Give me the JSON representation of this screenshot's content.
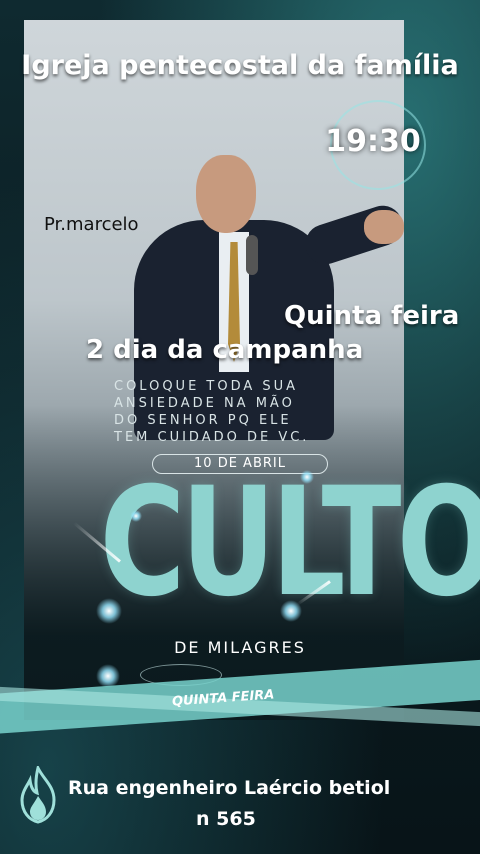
{
  "header": {
    "church_name": "Igreja pentecostal da família",
    "time": "19:30"
  },
  "pastor": "Pr.marcelo",
  "weekday": "Quinta feira",
  "campaign": "2 dia da campanha",
  "verse_lines": [
    "COLOQUE TODA SUA",
    "ANSIEDADE NA MÃO",
    "DO SENHOR PQ ELE",
    "TEM CUIDADO DE VC."
  ],
  "date": "10 DE ABRIL",
  "event": {
    "main": "CULTO",
    "sub": "DE MILAGRES",
    "band_label": "QUINTA FEIRA"
  },
  "address": {
    "line1": "Rua engenheiro Laércio betiol",
    "line2": "n 565"
  },
  "icons": [
    "flame-icon"
  ],
  "colors": {
    "accent": "#8ed3cf",
    "background": "#0b1a1f"
  }
}
